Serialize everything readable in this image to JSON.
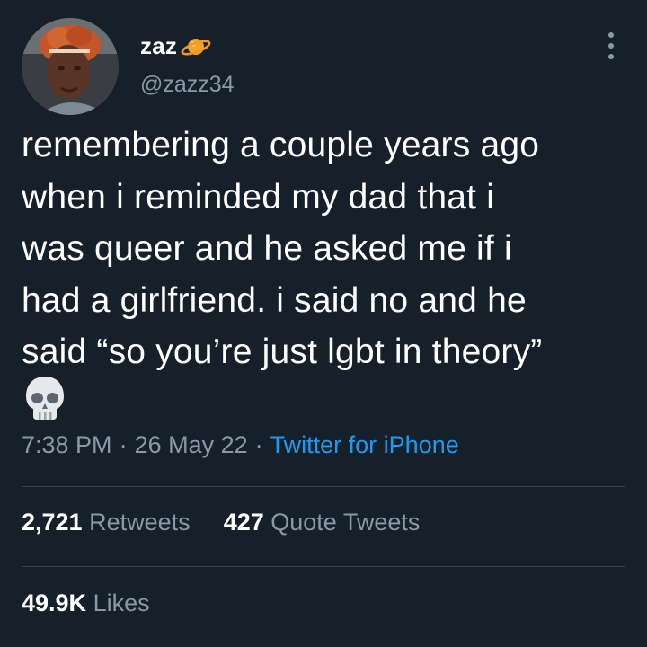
{
  "user": {
    "display_name": "zaz",
    "handle": "@zazz34",
    "name_emoji": "ringed-planet-icon"
  },
  "tweet": {
    "text": "remembering a couple years ago\nwhen i reminded my dad that i\nwas queer and he asked me if i\nhad a girlfriend. i said no and he\nsaid “so you’re just lgbt in theory”",
    "trailing_emoji": "skull-icon"
  },
  "meta": {
    "time": "7:38 PM",
    "separator": "·",
    "date": "26 May 22",
    "source": "Twitter for iPhone"
  },
  "stats": {
    "retweets_count": "2,721",
    "retweets_label": "Retweets",
    "quotes_count": "427",
    "quotes_label": "Quote Tweets",
    "likes_count": "49.9K",
    "likes_label": "Likes"
  },
  "colors": {
    "background": "#15202b",
    "text": "#ffffff",
    "secondary": "#8b98a5",
    "link": "#1d9bf0",
    "divider": "#38444d"
  }
}
